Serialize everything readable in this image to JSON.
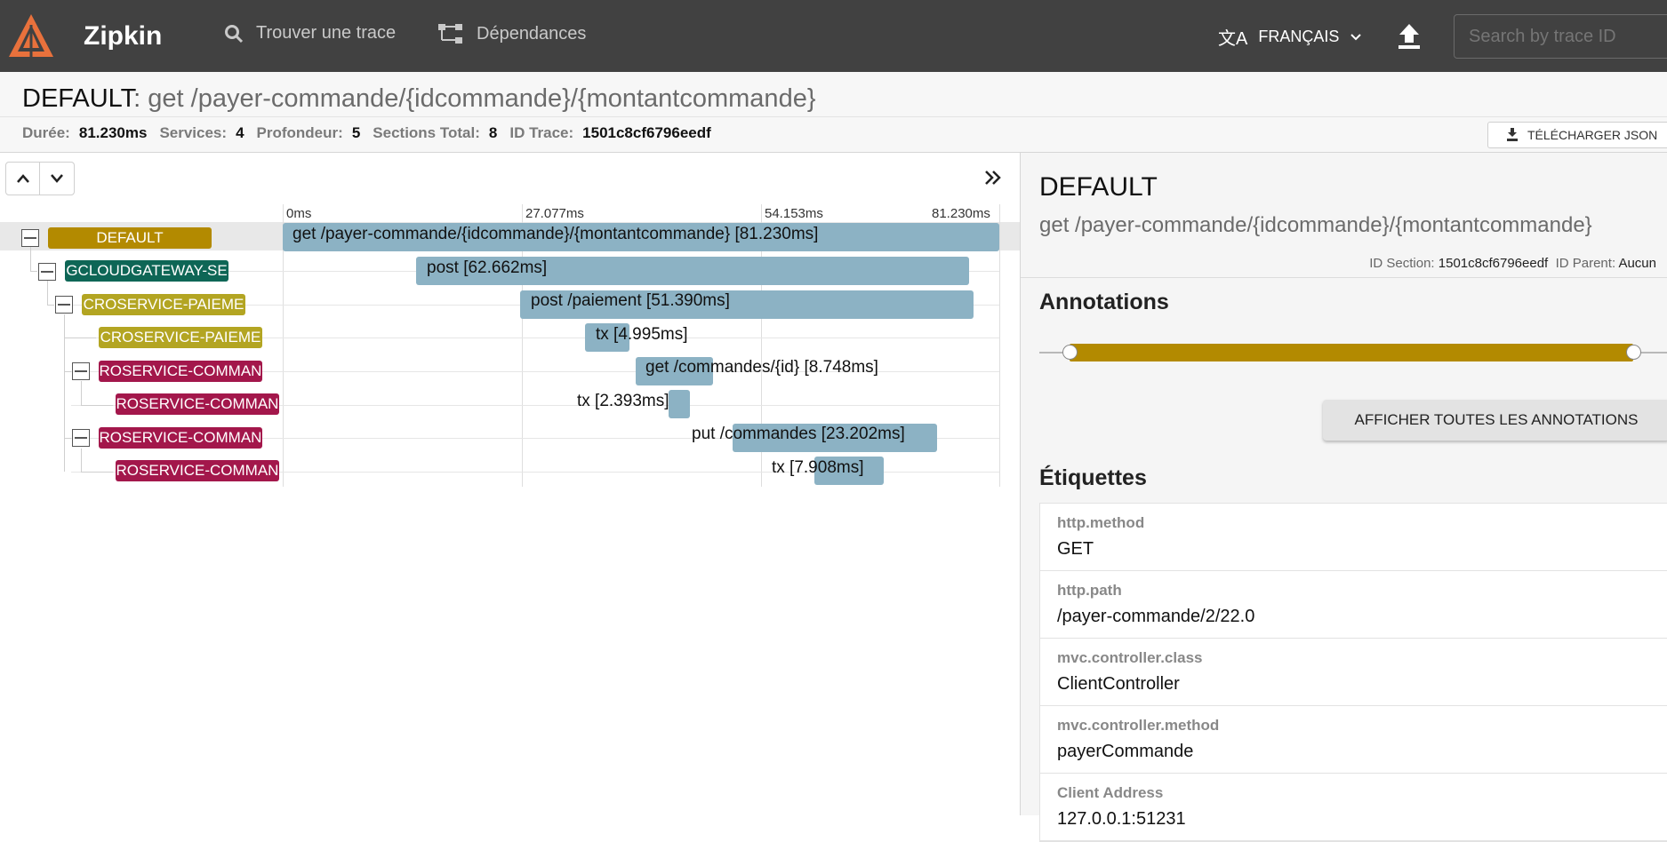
{
  "topbar": {
    "brand": "Zipkin",
    "nav": [
      {
        "label": "Trouver une trace",
        "icon": "search-icon"
      },
      {
        "label": "Dépendances",
        "icon": "dependencies-icon"
      }
    ],
    "language": "FRANÇAIS",
    "search_placeholder": "Search by trace ID",
    "colors": {
      "bar": "#414141",
      "logo": "#e8713c"
    }
  },
  "header": {
    "service": "DEFAULT",
    "separator": ": ",
    "span_name": "get /payer-commande/{idcommande}/{montantcommande}",
    "meta": [
      {
        "key": "Durée:",
        "value": "81.230ms"
      },
      {
        "key": "Services:",
        "value": "4"
      },
      {
        "key": "Profondeur:",
        "value": "5"
      },
      {
        "key": "Sections Total:",
        "value": "8"
      },
      {
        "key": "ID Trace:",
        "value": "1501c8cf6796eedf"
      }
    ],
    "download_label": "TÉLÉCHARGER JSON"
  },
  "timeline": {
    "ticks": [
      "0ms",
      "27.077ms",
      "54.153ms",
      "81.230ms"
    ],
    "rows": [
      {
        "service": "DEFAULT",
        "label": "get /payer-commande/{idcommande}/{montantcommande} [81.230ms]"
      },
      {
        "service": "GCLOUDGATEWAY-SE",
        "label": "post [62.662ms]"
      },
      {
        "service": "CROSERVICE-PAIEME",
        "label": "post /paiement [51.390ms]"
      },
      {
        "service": "CROSERVICE-PAIEME",
        "label": "tx [4.995ms]"
      },
      {
        "service": "ROSERVICE-COMMAN",
        "label": "get /commandes/{id} [8.748ms]"
      },
      {
        "service": "ROSERVICE-COMMAN",
        "label": "tx [2.393ms]"
      },
      {
        "service": "ROSERVICE-COMMAN",
        "label": "put /commandes [23.202ms]"
      },
      {
        "service": "ROSERVICE-COMMAN",
        "label": "tx [7.908ms]"
      }
    ],
    "colors": {
      "default": "#b38a00",
      "gateway": "#0e6656",
      "paiement": "#b3a522",
      "commande": "#a3174b",
      "span_bar": "#8cb2c4"
    }
  },
  "detail": {
    "service": "DEFAULT",
    "span_name": "get /payer-commande/{idcommande}/{montantcommande}",
    "section_id_label": "ID Section:",
    "section_id": "1501c8cf6796eedf",
    "parent_id_label": "ID Parent:",
    "parent_id": "Aucun",
    "annotations_title": "Annotations",
    "show_all_label": "AFFICHER TOUTES LES ANNOTATIONS",
    "tags_title": "Étiquettes",
    "tags": [
      {
        "key": "http.method",
        "value": "GET"
      },
      {
        "key": "http.path",
        "value": "/payer-commande/2/22.0"
      },
      {
        "key": "mvc.controller.class",
        "value": "ClientController"
      },
      {
        "key": "mvc.controller.method",
        "value": "payerCommande"
      },
      {
        "key": "Client Address",
        "value": "127.0.0.1:51231"
      }
    ]
  }
}
